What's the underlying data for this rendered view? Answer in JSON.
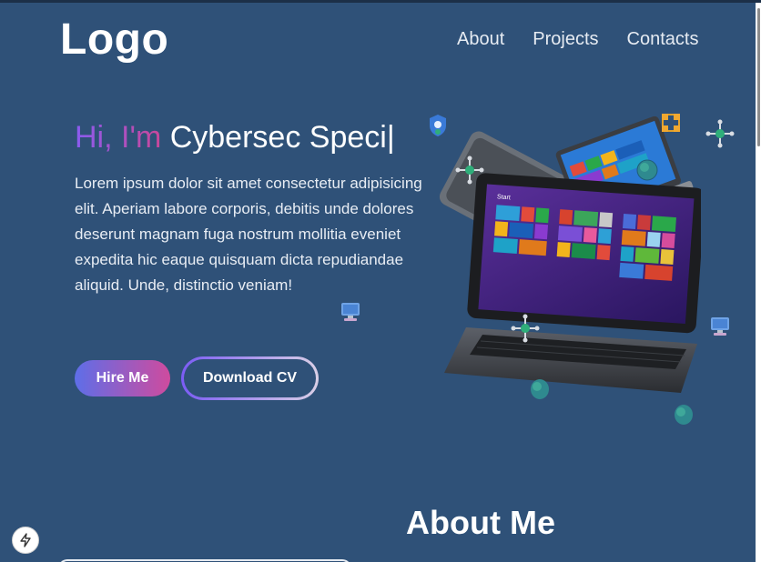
{
  "header": {
    "logo": "Logo",
    "nav": [
      {
        "label": "About"
      },
      {
        "label": "Projects"
      },
      {
        "label": "Contacts"
      }
    ]
  },
  "hero": {
    "greeting": "Hi, I'm",
    "typed_role": "Cybersec Speci",
    "cursor": "|",
    "description": "Lorem ipsum dolor sit amet consectetur adipisicing elit. Aperiam labore corporis, debitis unde dolores deserunt magnam fuga nostrum mollitia eveniet expedita hic eaque quisquam dicta repudiandae aliquid. Unde, distinctio veniam!",
    "buttons": {
      "hire": "Hire Me",
      "download": "Download CV"
    },
    "image": {
      "icon": "laptops-illustration",
      "screen_label": "Start"
    }
  },
  "about": {
    "title": "About Me"
  },
  "floating_icons": [
    "network-node-icon",
    "globe-icon",
    "monitor-icon",
    "shield-bug-icon",
    "network-box-icon"
  ],
  "colors": {
    "background": "#2f5178",
    "accent_purple": "#8a5cf0",
    "accent_pink": "#c9479a"
  }
}
